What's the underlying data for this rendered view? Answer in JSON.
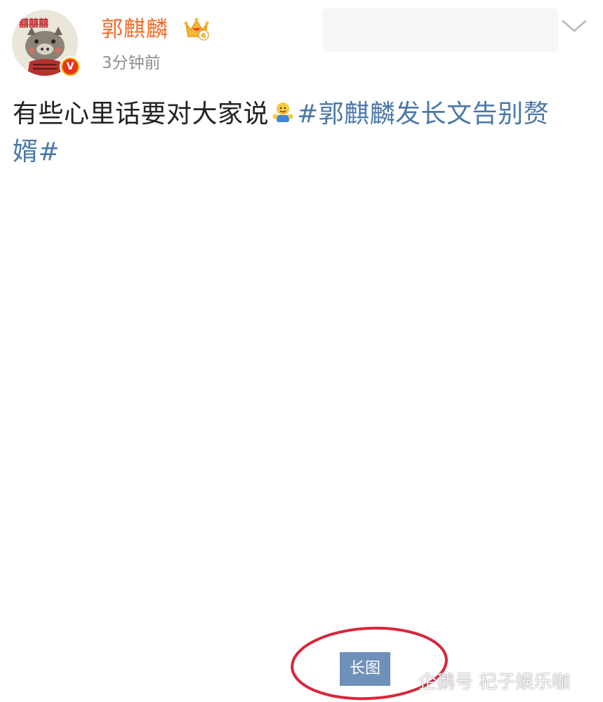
{
  "post": {
    "author": {
      "name": "郭麒麟",
      "avatar_icon": "pig-avatar-icon",
      "verified_icon": "verified-v-badge-icon",
      "verified_letter": "V",
      "vip_icon": "vip-crown-icon",
      "vip_level": "6"
    },
    "timestamp": "3分钟前",
    "text_plain": "有些心里话要对大家说",
    "emoji_icon": "hug-emoji-icon",
    "hashtag": "#郭麒麟发长文告别赘婿#",
    "long_image_label": "长图"
  },
  "watermark": {
    "icon": "penguin-icon",
    "text": "企鹅号 杞子娱乐咖"
  },
  "colors": {
    "username": "#f26c2a",
    "hashtag": "#4a78a8",
    "timestamp": "#8f8f8f",
    "long_image_bg": "#6e90b9",
    "annotation_circle": "#d8263b"
  }
}
